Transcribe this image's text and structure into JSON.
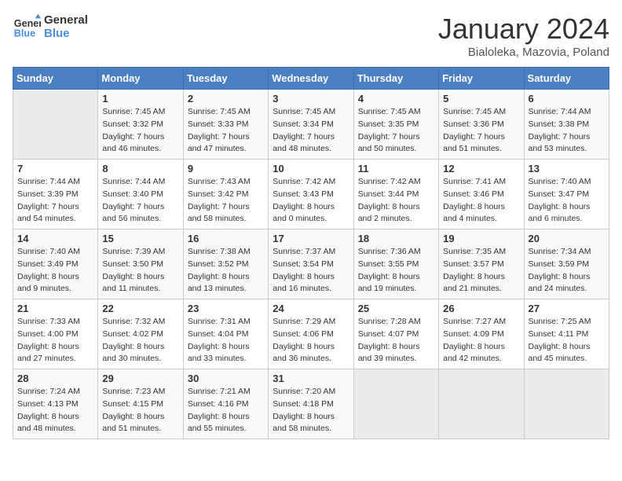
{
  "header": {
    "logo_line1": "General",
    "logo_line2": "Blue",
    "month": "January 2024",
    "location": "Bialoleka, Mazovia, Poland"
  },
  "days_of_week": [
    "Sunday",
    "Monday",
    "Tuesday",
    "Wednesday",
    "Thursday",
    "Friday",
    "Saturday"
  ],
  "weeks": [
    [
      {
        "day": "",
        "sunrise": "",
        "sunset": "",
        "daylight": ""
      },
      {
        "day": "1",
        "sunrise": "Sunrise: 7:45 AM",
        "sunset": "Sunset: 3:32 PM",
        "daylight": "Daylight: 7 hours and 46 minutes."
      },
      {
        "day": "2",
        "sunrise": "Sunrise: 7:45 AM",
        "sunset": "Sunset: 3:33 PM",
        "daylight": "Daylight: 7 hours and 47 minutes."
      },
      {
        "day": "3",
        "sunrise": "Sunrise: 7:45 AM",
        "sunset": "Sunset: 3:34 PM",
        "daylight": "Daylight: 7 hours and 48 minutes."
      },
      {
        "day": "4",
        "sunrise": "Sunrise: 7:45 AM",
        "sunset": "Sunset: 3:35 PM",
        "daylight": "Daylight: 7 hours and 50 minutes."
      },
      {
        "day": "5",
        "sunrise": "Sunrise: 7:45 AM",
        "sunset": "Sunset: 3:36 PM",
        "daylight": "Daylight: 7 hours and 51 minutes."
      },
      {
        "day": "6",
        "sunrise": "Sunrise: 7:44 AM",
        "sunset": "Sunset: 3:38 PM",
        "daylight": "Daylight: 7 hours and 53 minutes."
      }
    ],
    [
      {
        "day": "7",
        "sunrise": "Sunrise: 7:44 AM",
        "sunset": "Sunset: 3:39 PM",
        "daylight": "Daylight: 7 hours and 54 minutes."
      },
      {
        "day": "8",
        "sunrise": "Sunrise: 7:44 AM",
        "sunset": "Sunset: 3:40 PM",
        "daylight": "Daylight: 7 hours and 56 minutes."
      },
      {
        "day": "9",
        "sunrise": "Sunrise: 7:43 AM",
        "sunset": "Sunset: 3:42 PM",
        "daylight": "Daylight: 7 hours and 58 minutes."
      },
      {
        "day": "10",
        "sunrise": "Sunrise: 7:42 AM",
        "sunset": "Sunset: 3:43 PM",
        "daylight": "Daylight: 8 hours and 0 minutes."
      },
      {
        "day": "11",
        "sunrise": "Sunrise: 7:42 AM",
        "sunset": "Sunset: 3:44 PM",
        "daylight": "Daylight: 8 hours and 2 minutes."
      },
      {
        "day": "12",
        "sunrise": "Sunrise: 7:41 AM",
        "sunset": "Sunset: 3:46 PM",
        "daylight": "Daylight: 8 hours and 4 minutes."
      },
      {
        "day": "13",
        "sunrise": "Sunrise: 7:40 AM",
        "sunset": "Sunset: 3:47 PM",
        "daylight": "Daylight: 8 hours and 6 minutes."
      }
    ],
    [
      {
        "day": "14",
        "sunrise": "Sunrise: 7:40 AM",
        "sunset": "Sunset: 3:49 PM",
        "daylight": "Daylight: 8 hours and 9 minutes."
      },
      {
        "day": "15",
        "sunrise": "Sunrise: 7:39 AM",
        "sunset": "Sunset: 3:50 PM",
        "daylight": "Daylight: 8 hours and 11 minutes."
      },
      {
        "day": "16",
        "sunrise": "Sunrise: 7:38 AM",
        "sunset": "Sunset: 3:52 PM",
        "daylight": "Daylight: 8 hours and 13 minutes."
      },
      {
        "day": "17",
        "sunrise": "Sunrise: 7:37 AM",
        "sunset": "Sunset: 3:54 PM",
        "daylight": "Daylight: 8 hours and 16 minutes."
      },
      {
        "day": "18",
        "sunrise": "Sunrise: 7:36 AM",
        "sunset": "Sunset: 3:55 PM",
        "daylight": "Daylight: 8 hours and 19 minutes."
      },
      {
        "day": "19",
        "sunrise": "Sunrise: 7:35 AM",
        "sunset": "Sunset: 3:57 PM",
        "daylight": "Daylight: 8 hours and 21 minutes."
      },
      {
        "day": "20",
        "sunrise": "Sunrise: 7:34 AM",
        "sunset": "Sunset: 3:59 PM",
        "daylight": "Daylight: 8 hours and 24 minutes."
      }
    ],
    [
      {
        "day": "21",
        "sunrise": "Sunrise: 7:33 AM",
        "sunset": "Sunset: 4:00 PM",
        "daylight": "Daylight: 8 hours and 27 minutes."
      },
      {
        "day": "22",
        "sunrise": "Sunrise: 7:32 AM",
        "sunset": "Sunset: 4:02 PM",
        "daylight": "Daylight: 8 hours and 30 minutes."
      },
      {
        "day": "23",
        "sunrise": "Sunrise: 7:31 AM",
        "sunset": "Sunset: 4:04 PM",
        "daylight": "Daylight: 8 hours and 33 minutes."
      },
      {
        "day": "24",
        "sunrise": "Sunrise: 7:29 AM",
        "sunset": "Sunset: 4:06 PM",
        "daylight": "Daylight: 8 hours and 36 minutes."
      },
      {
        "day": "25",
        "sunrise": "Sunrise: 7:28 AM",
        "sunset": "Sunset: 4:07 PM",
        "daylight": "Daylight: 8 hours and 39 minutes."
      },
      {
        "day": "26",
        "sunrise": "Sunrise: 7:27 AM",
        "sunset": "Sunset: 4:09 PM",
        "daylight": "Daylight: 8 hours and 42 minutes."
      },
      {
        "day": "27",
        "sunrise": "Sunrise: 7:25 AM",
        "sunset": "Sunset: 4:11 PM",
        "daylight": "Daylight: 8 hours and 45 minutes."
      }
    ],
    [
      {
        "day": "28",
        "sunrise": "Sunrise: 7:24 AM",
        "sunset": "Sunset: 4:13 PM",
        "daylight": "Daylight: 8 hours and 48 minutes."
      },
      {
        "day": "29",
        "sunrise": "Sunrise: 7:23 AM",
        "sunset": "Sunset: 4:15 PM",
        "daylight": "Daylight: 8 hours and 51 minutes."
      },
      {
        "day": "30",
        "sunrise": "Sunrise: 7:21 AM",
        "sunset": "Sunset: 4:16 PM",
        "daylight": "Daylight: 8 hours and 55 minutes."
      },
      {
        "day": "31",
        "sunrise": "Sunrise: 7:20 AM",
        "sunset": "Sunset: 4:18 PM",
        "daylight": "Daylight: 8 hours and 58 minutes."
      },
      {
        "day": "",
        "sunrise": "",
        "sunset": "",
        "daylight": ""
      },
      {
        "day": "",
        "sunrise": "",
        "sunset": "",
        "daylight": ""
      },
      {
        "day": "",
        "sunrise": "",
        "sunset": "",
        "daylight": ""
      }
    ]
  ]
}
